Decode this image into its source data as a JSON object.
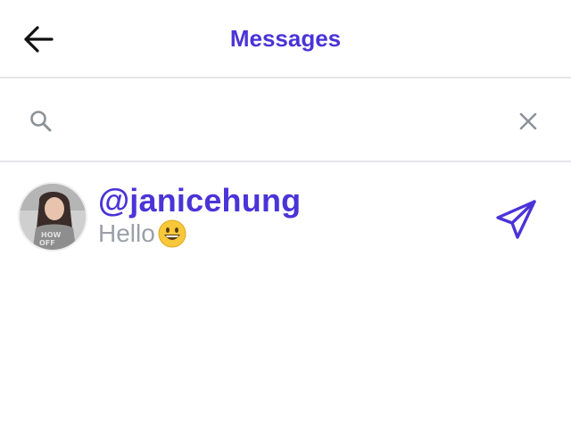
{
  "header": {
    "title": "Messages",
    "back_icon": "arrow-left-icon"
  },
  "search": {
    "value": "",
    "placeholder": "",
    "icon": "search-icon",
    "clear_icon": "close-icon"
  },
  "conversations": [
    {
      "username": "@janicehung",
      "preview": "Hello",
      "preview_emoji": "grinning-face",
      "avatar": "user-avatar-photo",
      "action_icon": "send-icon"
    }
  ],
  "colors": {
    "accent": "#4a34d8",
    "muted": "#9aa0a8",
    "divider": "#e6e6ea"
  }
}
